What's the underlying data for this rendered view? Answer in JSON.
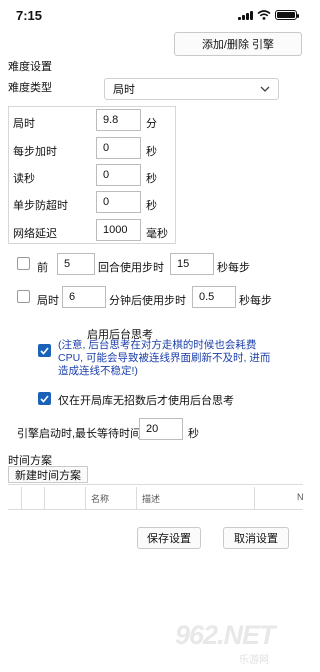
{
  "status_bar": {
    "time": "7:15"
  },
  "toolbar": {
    "add_remove_engine": "添加/删除 引擎"
  },
  "difficulty": {
    "section_title": "难度设置",
    "type_label": "难度类型",
    "type_value": "局时"
  },
  "params": {
    "rows": [
      {
        "label": "局时",
        "value": "9.8",
        "unit": "分"
      },
      {
        "label": "每步加时",
        "value": "0",
        "unit": "秒"
      },
      {
        "label": "读秒",
        "value": "0",
        "unit": "秒"
      },
      {
        "label": "单步防超时",
        "value": "0",
        "unit": "秒"
      },
      {
        "label": "网络延迟",
        "value": "1000",
        "unit": "毫秒"
      }
    ]
  },
  "rule1": {
    "checked": false,
    "prefix": "前",
    "rounds": "5",
    "mid": "回合使用步时",
    "seconds": "15",
    "suffix": "秒每步"
  },
  "rule2": {
    "checked": false,
    "prefix": "局时",
    "minutes": "6",
    "mid": "分钟后使用步时",
    "seconds": "0.5",
    "suffix": "秒每步"
  },
  "background_thinking": {
    "checked": true,
    "title": "启用后台思考",
    "warning_line1": "(注意, 后台思考在对方走棋的时候也会耗费",
    "warning_line2": "CPU, 可能会导致被连线界面刷新不及时, 进而",
    "warning_line3": "造成连线不稳定!)"
  },
  "book_only": {
    "checked": true,
    "label": "仅在开局库无招数后才使用后台思考"
  },
  "engine_wait": {
    "label": "引擎启动时,最长等待时间",
    "value": "20",
    "unit": "秒"
  },
  "time_scheme": {
    "title": "时间方案",
    "new_button": "新建时间方案",
    "columns": [
      "名称",
      "描述",
      "N"
    ]
  },
  "footer": {
    "save": "保存设置",
    "cancel": "取消设置"
  },
  "watermark": {
    "logo": "962.NET",
    "sub": "乐游网"
  }
}
